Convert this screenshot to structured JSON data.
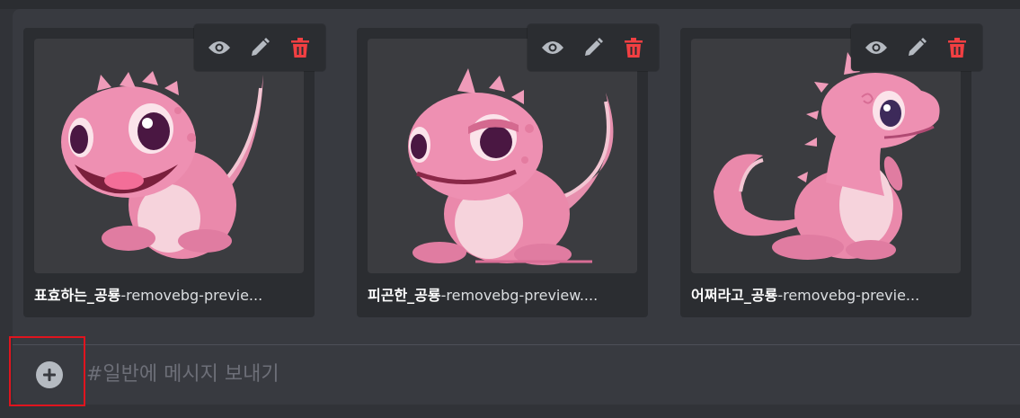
{
  "attachments": [
    {
      "filename_ko": "표효하는_공룡",
      "filename_rest": "-removebg-previe...",
      "image_alt": "roaring pink dinosaur"
    },
    {
      "filename_ko": "피곤한_공룡",
      "filename_rest": "-removebg-preview....",
      "image_alt": "tired pink dinosaur"
    },
    {
      "filename_ko": "어쩌라고_공룡",
      "filename_rest": "-removebg-previe...",
      "image_alt": "so-what pink dinosaur"
    }
  ],
  "actions": {
    "view_icon": "eye-icon",
    "edit_icon": "pencil-icon",
    "delete_icon": "trash-icon"
  },
  "composer": {
    "placeholder": "#일반에 메시지 보내기",
    "add_icon": "plus-circle-icon"
  },
  "colors": {
    "background": "#313338",
    "composer": "#383a40",
    "card": "#2b2d31",
    "delete_red": "#f23f42",
    "highlight": "#e0141e"
  }
}
